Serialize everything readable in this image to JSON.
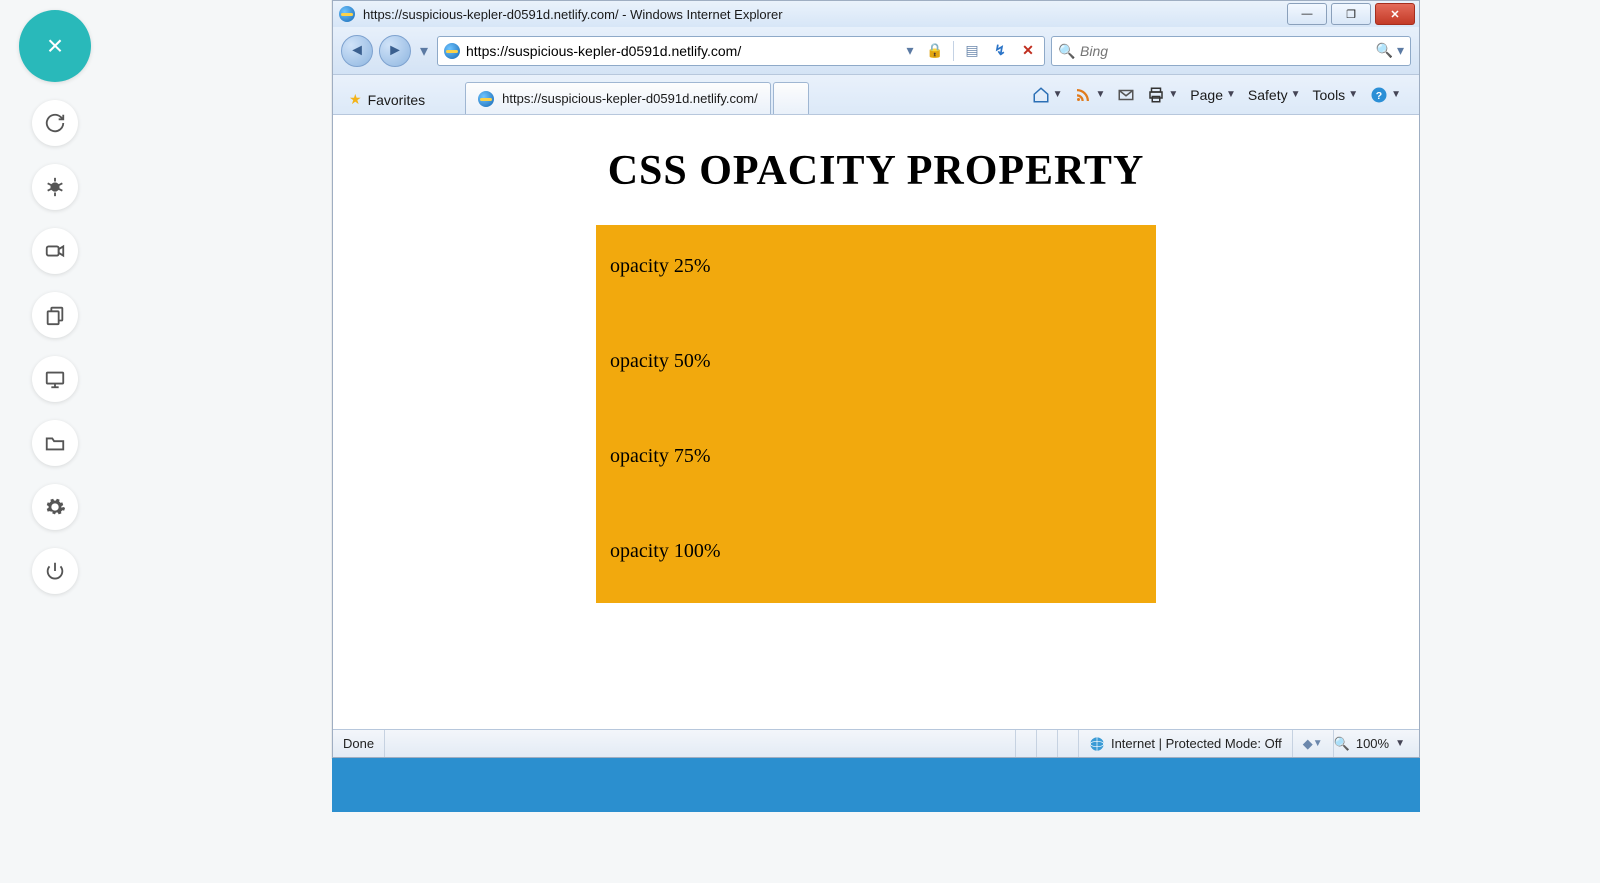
{
  "sidebar": {
    "close_label": "×",
    "items": [
      "sync",
      "bug",
      "video",
      "clipboard",
      "display",
      "folder",
      "settings",
      "power"
    ]
  },
  "window": {
    "title": "https://suspicious-kepler-d0591d.netlify.com/ - Windows Internet Explorer",
    "address": "https://suspicious-kepler-d0591d.netlify.com/",
    "search_placeholder": "Bing",
    "favorites_label": "Favorites",
    "tab_title": "https://suspicious-kepler-d0591d.netlify.com/",
    "cmd": {
      "page": "Page",
      "safety": "Safety",
      "tools": "Tools"
    }
  },
  "page": {
    "heading": "CSS OPACITY PROPERTY",
    "lines": [
      "opacity 25%",
      "opacity 50%",
      "opacity 75%",
      "opacity 100%"
    ]
  },
  "status": {
    "done": "Done",
    "zone": "Internet | Protected Mode: Off",
    "zoom": "100%"
  }
}
